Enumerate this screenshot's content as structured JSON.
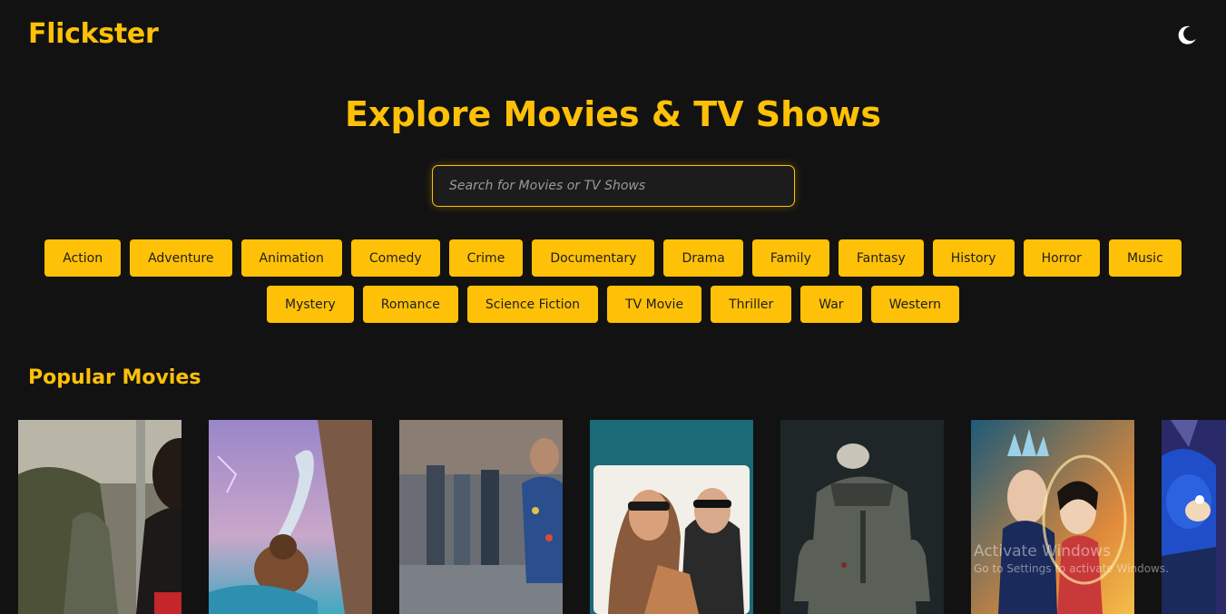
{
  "header": {
    "logo": "Flickster",
    "theme_toggle_icon": "moon-icon"
  },
  "hero": {
    "title": "Explore Movies & TV Shows"
  },
  "search": {
    "placeholder": "Search for Movies or TV Shows",
    "value": ""
  },
  "genres": {
    "row1": [
      "Action",
      "Adventure",
      "Animation",
      "Comedy",
      "Crime",
      "Documentary",
      "Drama",
      "Family",
      "Fantasy",
      "History",
      "Horror",
      "Music"
    ],
    "row2": [
      "Mystery",
      "Romance",
      "Science Fiction",
      "TV Movie",
      "Thriller",
      "War",
      "Western"
    ]
  },
  "popular": {
    "title": "Popular Movies"
  },
  "watermark": {
    "title": "Activate Windows",
    "subtitle": "Go to Settings to activate Windows."
  },
  "colors": {
    "accent": "#ffc107",
    "background": "#121212",
    "button_text": "#1e1e1e"
  }
}
